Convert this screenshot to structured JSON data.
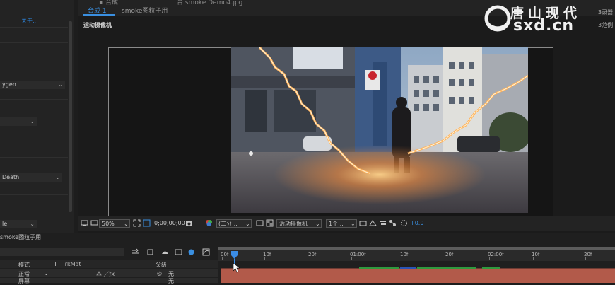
{
  "left_panel": {
    "link_text": "关于...",
    "dropdowns": [
      {
        "value": "ygen"
      },
      {
        "value": ""
      },
      {
        "value": "Death"
      },
      {
        "value": "le"
      }
    ]
  },
  "composition": {
    "tabs": [
      {
        "label": "合成 1"
      },
      {
        "label": "smoke图粒子用"
      }
    ],
    "partial_tab_text": "合 smoke Demo4.jpg",
    "name_label": "运动摄像机",
    "right_labels": [
      "3录器",
      "3范例"
    ]
  },
  "watermark": {
    "text_cn": "唐山现代",
    "text_en": "sxd.cn"
  },
  "viewer_toolbar": {
    "zoom": "50%",
    "timecode": "0;00;00;00",
    "resolution": "(二分...",
    "camera": "活动摄像机",
    "views": "1个...",
    "exposure": "+0.0"
  },
  "timeline": {
    "comp_tab": "smoke图粒子用",
    "headers": {
      "mode": "模式",
      "t": "T",
      "trkmat": "TrkMat",
      "parent": "父级"
    },
    "rows": [
      {
        "mode": "正常",
        "parent": "无"
      },
      {
        "mode": "屏幕",
        "parent": "无"
      }
    ],
    "ruler_labels": [
      "00f",
      "10f",
      "20f",
      "01:00f",
      "10f",
      "20f",
      "02:00f",
      "10f",
      "20f"
    ],
    "current_time_frame": 2
  },
  "colors": {
    "accent_blue": "#3a8fe0",
    "layer_bar": "#b25a4a",
    "key_green": "#2f9a3e"
  }
}
